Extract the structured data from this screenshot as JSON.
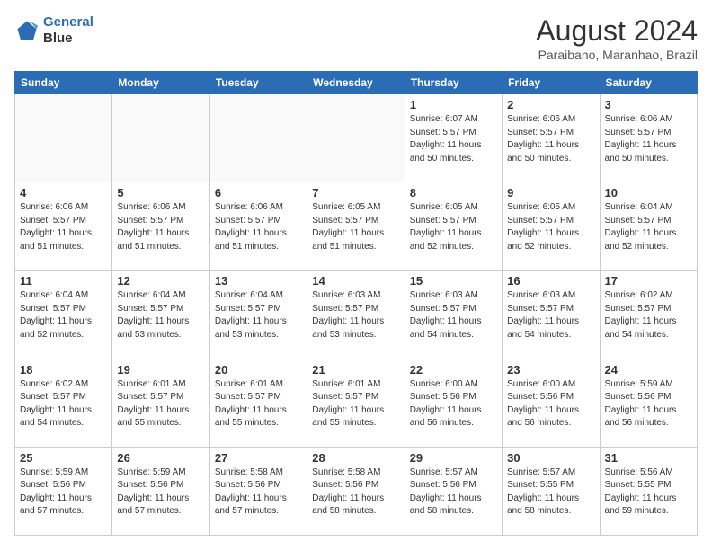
{
  "header": {
    "logo_line1": "General",
    "logo_line2": "Blue",
    "month": "August 2024",
    "location": "Paraibano, Maranhao, Brazil"
  },
  "weekdays": [
    "Sunday",
    "Monday",
    "Tuesday",
    "Wednesday",
    "Thursday",
    "Friday",
    "Saturday"
  ],
  "weeks": [
    [
      {
        "day": "",
        "info": ""
      },
      {
        "day": "",
        "info": ""
      },
      {
        "day": "",
        "info": ""
      },
      {
        "day": "",
        "info": ""
      },
      {
        "day": "1",
        "info": "Sunrise: 6:07 AM\nSunset: 5:57 PM\nDaylight: 11 hours\nand 50 minutes."
      },
      {
        "day": "2",
        "info": "Sunrise: 6:06 AM\nSunset: 5:57 PM\nDaylight: 11 hours\nand 50 minutes."
      },
      {
        "day": "3",
        "info": "Sunrise: 6:06 AM\nSunset: 5:57 PM\nDaylight: 11 hours\nand 50 minutes."
      }
    ],
    [
      {
        "day": "4",
        "info": "Sunrise: 6:06 AM\nSunset: 5:57 PM\nDaylight: 11 hours\nand 51 minutes."
      },
      {
        "day": "5",
        "info": "Sunrise: 6:06 AM\nSunset: 5:57 PM\nDaylight: 11 hours\nand 51 minutes."
      },
      {
        "day": "6",
        "info": "Sunrise: 6:06 AM\nSunset: 5:57 PM\nDaylight: 11 hours\nand 51 minutes."
      },
      {
        "day": "7",
        "info": "Sunrise: 6:05 AM\nSunset: 5:57 PM\nDaylight: 11 hours\nand 51 minutes."
      },
      {
        "day": "8",
        "info": "Sunrise: 6:05 AM\nSunset: 5:57 PM\nDaylight: 11 hours\nand 52 minutes."
      },
      {
        "day": "9",
        "info": "Sunrise: 6:05 AM\nSunset: 5:57 PM\nDaylight: 11 hours\nand 52 minutes."
      },
      {
        "day": "10",
        "info": "Sunrise: 6:04 AM\nSunset: 5:57 PM\nDaylight: 11 hours\nand 52 minutes."
      }
    ],
    [
      {
        "day": "11",
        "info": "Sunrise: 6:04 AM\nSunset: 5:57 PM\nDaylight: 11 hours\nand 52 minutes."
      },
      {
        "day": "12",
        "info": "Sunrise: 6:04 AM\nSunset: 5:57 PM\nDaylight: 11 hours\nand 53 minutes."
      },
      {
        "day": "13",
        "info": "Sunrise: 6:04 AM\nSunset: 5:57 PM\nDaylight: 11 hours\nand 53 minutes."
      },
      {
        "day": "14",
        "info": "Sunrise: 6:03 AM\nSunset: 5:57 PM\nDaylight: 11 hours\nand 53 minutes."
      },
      {
        "day": "15",
        "info": "Sunrise: 6:03 AM\nSunset: 5:57 PM\nDaylight: 11 hours\nand 54 minutes."
      },
      {
        "day": "16",
        "info": "Sunrise: 6:03 AM\nSunset: 5:57 PM\nDaylight: 11 hours\nand 54 minutes."
      },
      {
        "day": "17",
        "info": "Sunrise: 6:02 AM\nSunset: 5:57 PM\nDaylight: 11 hours\nand 54 minutes."
      }
    ],
    [
      {
        "day": "18",
        "info": "Sunrise: 6:02 AM\nSunset: 5:57 PM\nDaylight: 11 hours\nand 54 minutes."
      },
      {
        "day": "19",
        "info": "Sunrise: 6:01 AM\nSunset: 5:57 PM\nDaylight: 11 hours\nand 55 minutes."
      },
      {
        "day": "20",
        "info": "Sunrise: 6:01 AM\nSunset: 5:57 PM\nDaylight: 11 hours\nand 55 minutes."
      },
      {
        "day": "21",
        "info": "Sunrise: 6:01 AM\nSunset: 5:57 PM\nDaylight: 11 hours\nand 55 minutes."
      },
      {
        "day": "22",
        "info": "Sunrise: 6:00 AM\nSunset: 5:56 PM\nDaylight: 11 hours\nand 56 minutes."
      },
      {
        "day": "23",
        "info": "Sunrise: 6:00 AM\nSunset: 5:56 PM\nDaylight: 11 hours\nand 56 minutes."
      },
      {
        "day": "24",
        "info": "Sunrise: 5:59 AM\nSunset: 5:56 PM\nDaylight: 11 hours\nand 56 minutes."
      }
    ],
    [
      {
        "day": "25",
        "info": "Sunrise: 5:59 AM\nSunset: 5:56 PM\nDaylight: 11 hours\nand 57 minutes."
      },
      {
        "day": "26",
        "info": "Sunrise: 5:59 AM\nSunset: 5:56 PM\nDaylight: 11 hours\nand 57 minutes."
      },
      {
        "day": "27",
        "info": "Sunrise: 5:58 AM\nSunset: 5:56 PM\nDaylight: 11 hours\nand 57 minutes."
      },
      {
        "day": "28",
        "info": "Sunrise: 5:58 AM\nSunset: 5:56 PM\nDaylight: 11 hours\nand 58 minutes."
      },
      {
        "day": "29",
        "info": "Sunrise: 5:57 AM\nSunset: 5:56 PM\nDaylight: 11 hours\nand 58 minutes."
      },
      {
        "day": "30",
        "info": "Sunrise: 5:57 AM\nSunset: 5:55 PM\nDaylight: 11 hours\nand 58 minutes."
      },
      {
        "day": "31",
        "info": "Sunrise: 5:56 AM\nSunset: 5:55 PM\nDaylight: 11 hours\nand 59 minutes."
      }
    ]
  ]
}
